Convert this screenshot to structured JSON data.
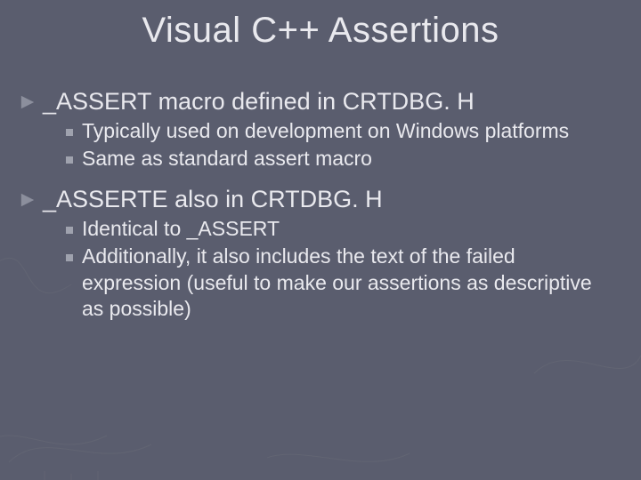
{
  "slide": {
    "title": "Visual C++ Assertions",
    "bullets": [
      {
        "text": "_ASSERT macro defined in CRTDBG. H",
        "sub": [
          "Typically used on development on Windows platforms",
          "Same as  standard assert macro"
        ]
      },
      {
        "text": "_ASSERTE also in CRTDBG. H",
        "sub": [
          "Identical to _ASSERT",
          "Additionally, it also includes the text of the failed expression (useful to make our assertions as descriptive as possible)"
        ]
      }
    ]
  },
  "colors": {
    "background": "#5a5d6e",
    "text": "#e9e9ee",
    "arrow": "#8c8f9d",
    "square": "#9fa2ae"
  }
}
